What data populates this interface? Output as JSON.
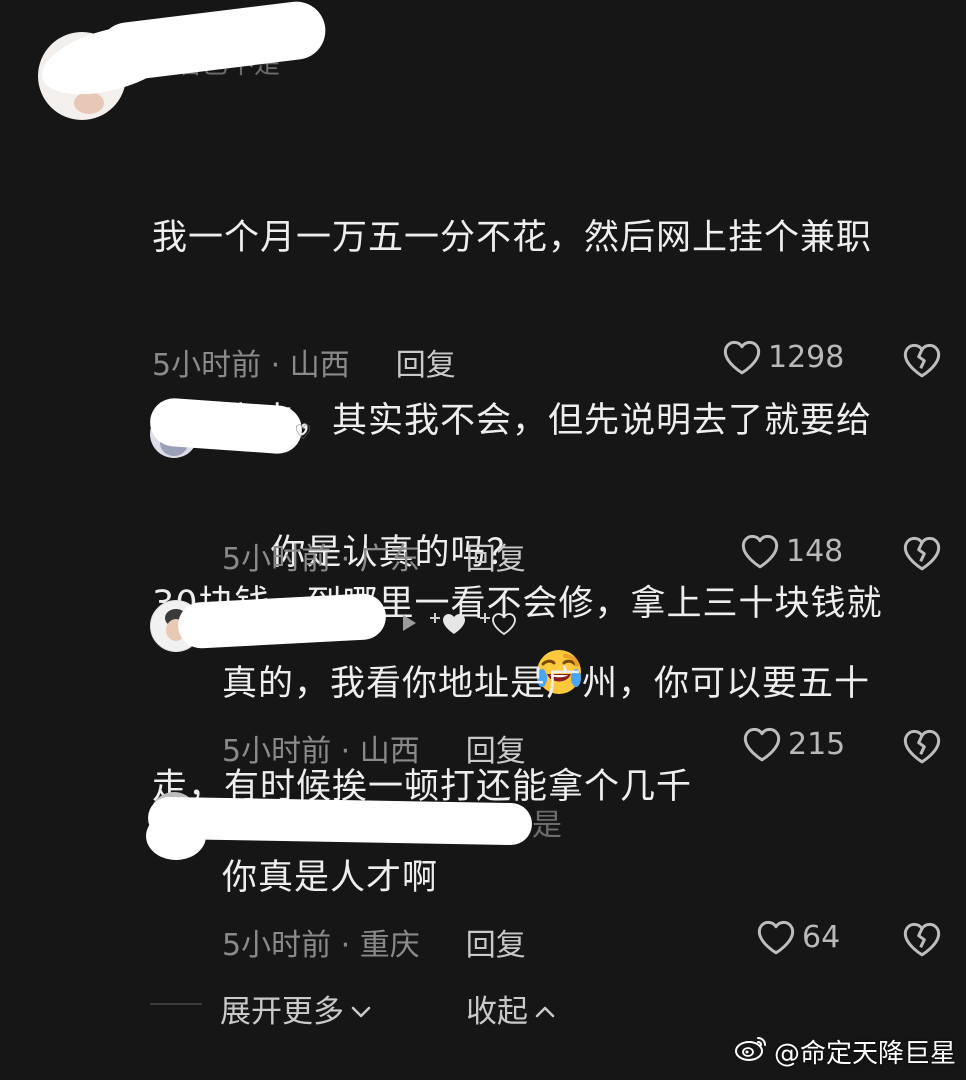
{
  "comments": [
    {
      "name_fragment": "一看巴不是",
      "text": "我一个月一万五一分不花，然后网上挂个兼职修理家电，其实我不会，但先说明去了就要给30块钱，到哪里一看不会修，拿上三十块钱就走，有时候挨一顿打还能拿个几千",
      "text_lines": [
        "我一个月一万五一分不花，然后网上挂个兼职",
        "修理家电，其实我不会，但先说明去了就要给",
        "30块钱，到哪里一看不会修，拿上三十块钱就",
        "走，有时候挨一顿打还能拿个几千"
      ],
      "meta": "5小时前 · 山西",
      "reply_label": "回复",
      "likes": "1298"
    },
    {
      "text": "你是认真的吗？",
      "emoji": "laughing-crying-emoji",
      "meta": "5小时前 · 广东",
      "reply_label": "回复",
      "likes": "148"
    },
    {
      "text": "真的，我看你地址是广州，你可以要五十",
      "meta": "5小时前 · 山西",
      "reply_label": "回复",
      "likes": "215",
      "badges": [
        "play-icon",
        "plus-heart-filled-icon",
        "plus-heart-outline-icon"
      ]
    },
    {
      "name_fragment": "是",
      "text": "你真是人才啊",
      "meta": "5小时前 · 重庆",
      "reply_label": "回复",
      "likes": "64"
    }
  ],
  "footer": {
    "expand_label": "展开更多",
    "collapse_label": "收起"
  },
  "watermark": {
    "text": "@命定天降巨星",
    "icon": "weibo-icon"
  },
  "colors": {
    "background": "#161616",
    "text": "#eeeeee",
    "meta": "#8a8a8a",
    "redaction": "#ffffff"
  }
}
